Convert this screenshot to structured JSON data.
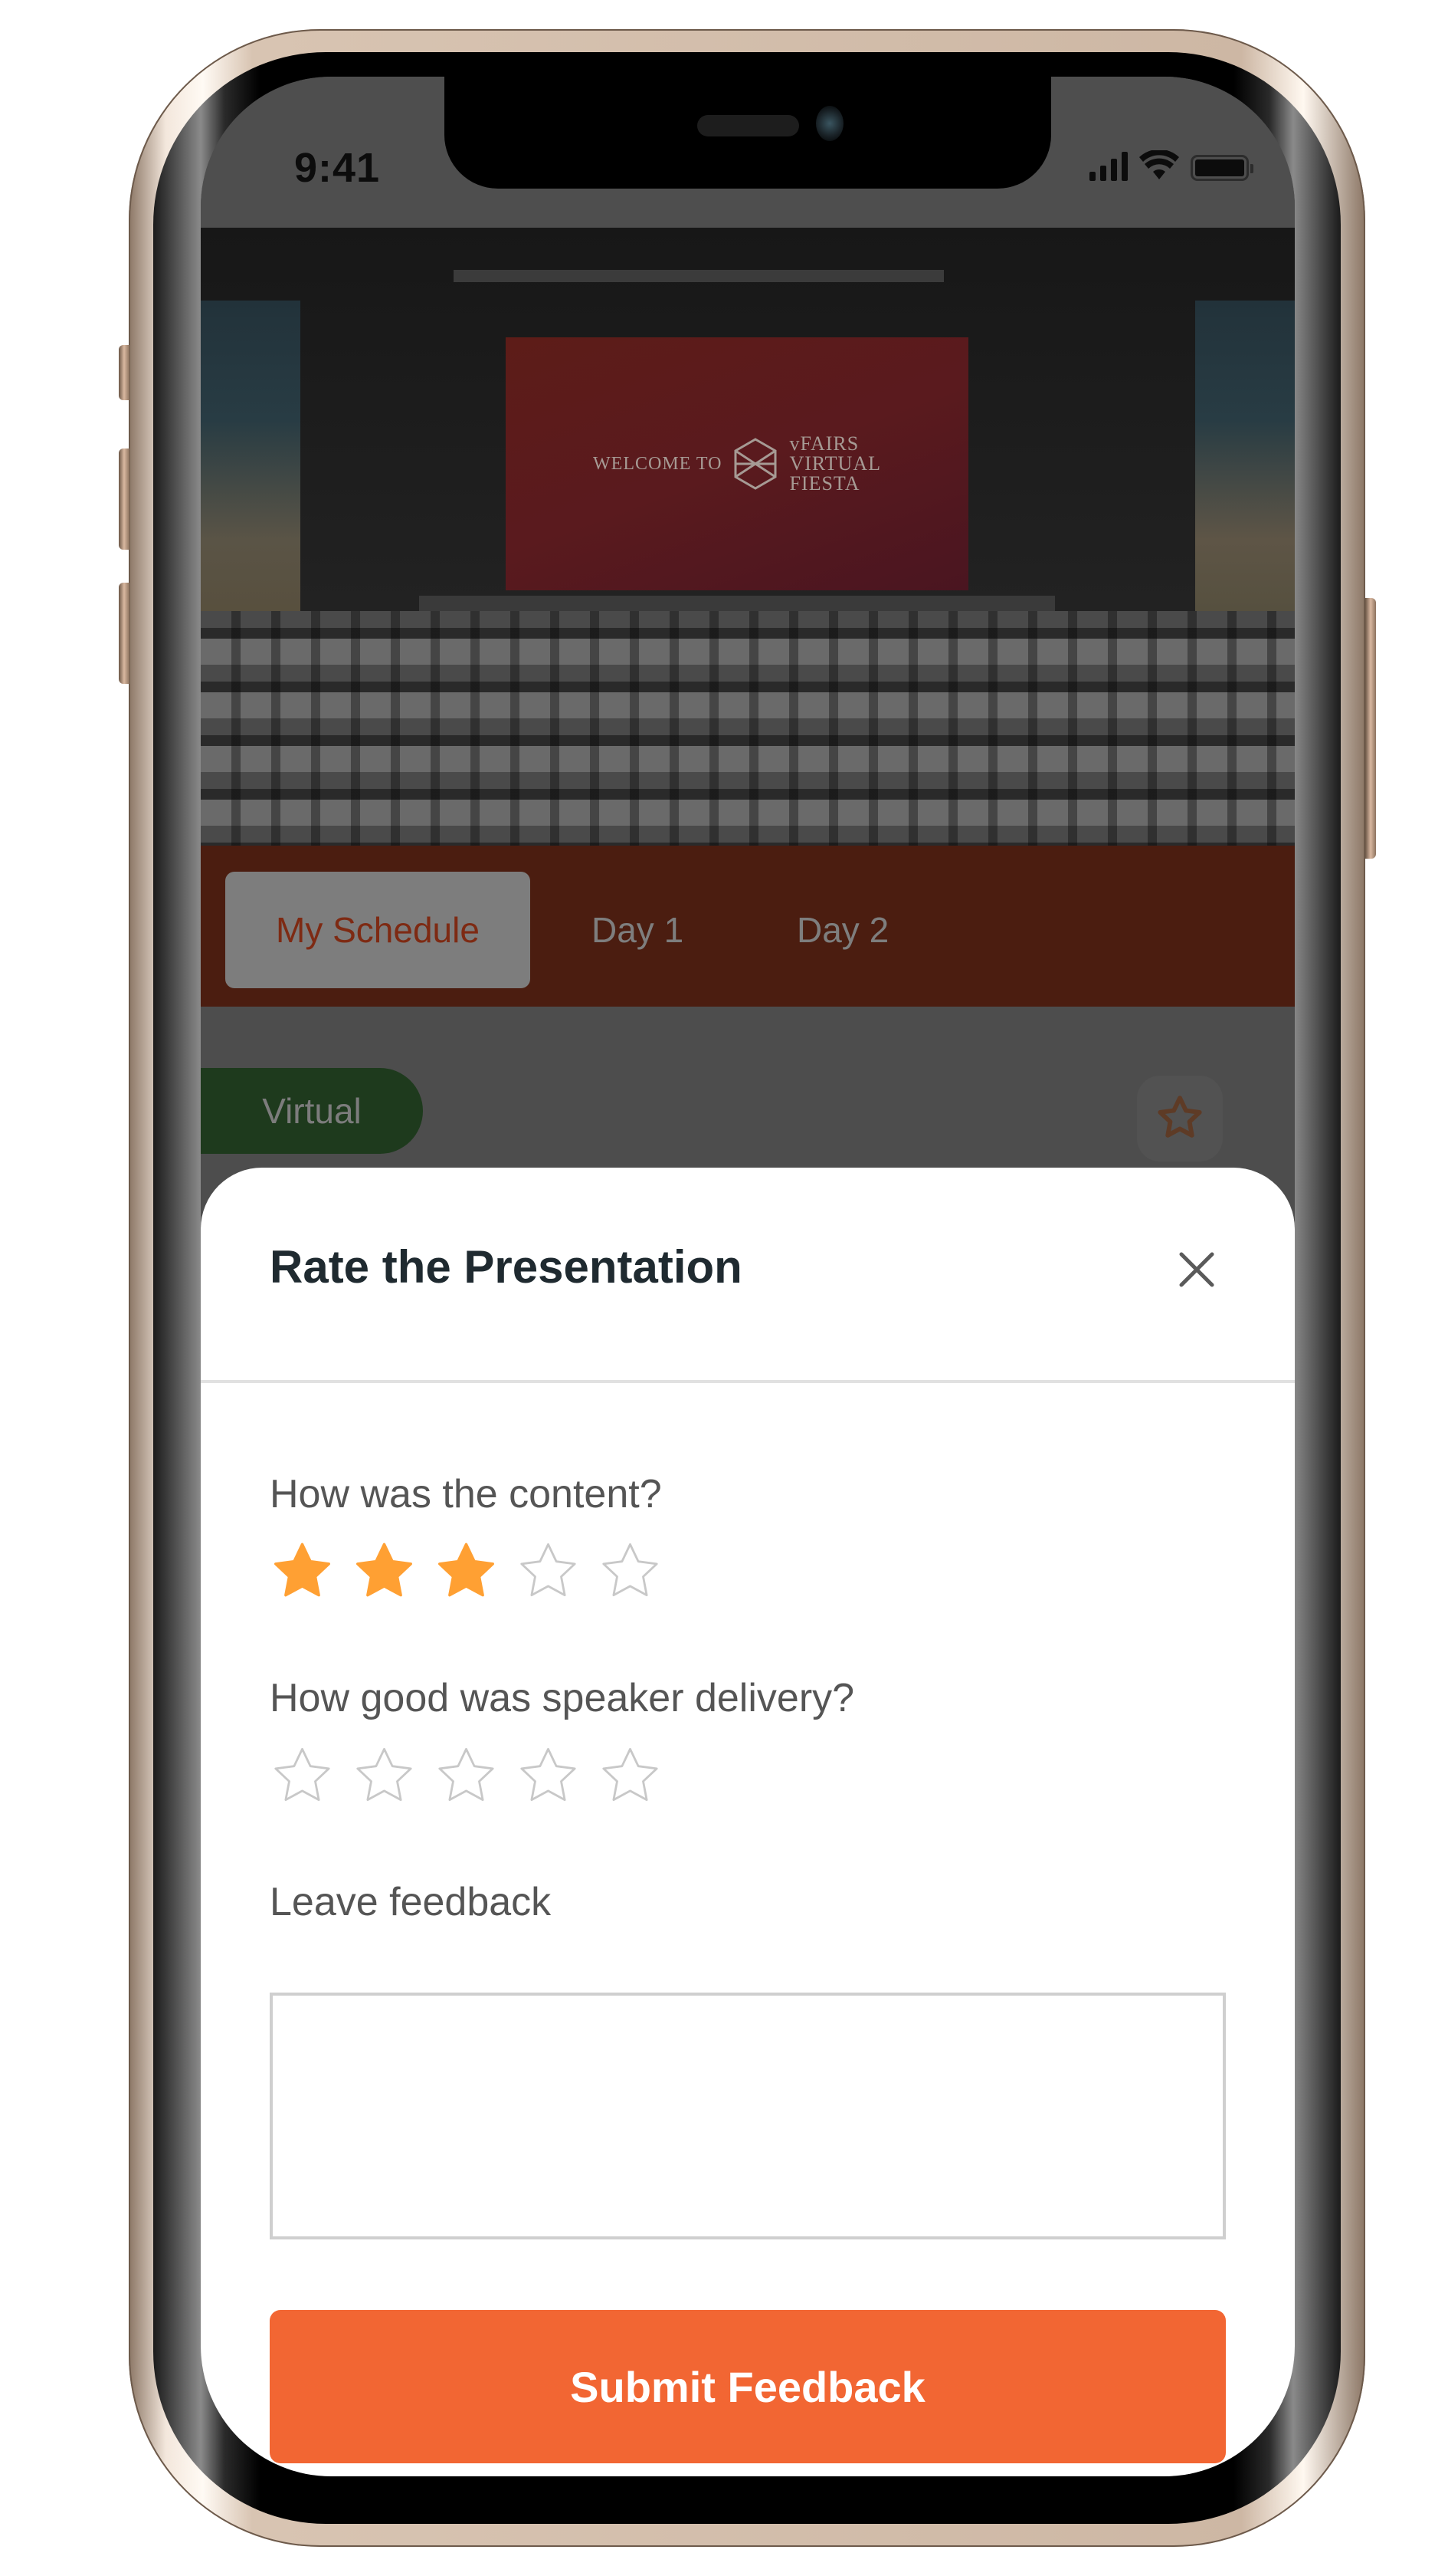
{
  "status_bar": {
    "time": "9:41",
    "icons": [
      "cellular-signal-icon",
      "wifi-icon",
      "battery-icon"
    ]
  },
  "banner": {
    "screen_text_left": "WELCOME TO",
    "screen_text_right_lines": [
      "vFAIRS",
      "VIRTUAL",
      "FIESTA"
    ],
    "logo_icon": "hexagon-logo-icon"
  },
  "tabs": [
    {
      "label": "My Schedule",
      "active": true
    },
    {
      "label": "Day 1",
      "active": false
    },
    {
      "label": "Day 2",
      "active": false
    }
  ],
  "session": {
    "badge": "Virtual",
    "favorite_icon": "star-outline-icon"
  },
  "modal": {
    "title": "Rate the Presentation",
    "close_icon": "close-icon",
    "questions": [
      {
        "label": "How was the content?",
        "rating": 3,
        "max": 5
      },
      {
        "label": "How good was speaker delivery?",
        "rating": 0,
        "max": 5
      }
    ],
    "feedback_label": "Leave feedback",
    "feedback_value": "",
    "submit_label": "Submit Feedback"
  },
  "colors": {
    "accent": "#F26633",
    "star_filled": "#FFA033",
    "star_empty": "#C8C8C8",
    "tab_bar": "#4B1D10",
    "virtual_badge": "#1E3A1D",
    "title_text": "#1F2A30"
  }
}
